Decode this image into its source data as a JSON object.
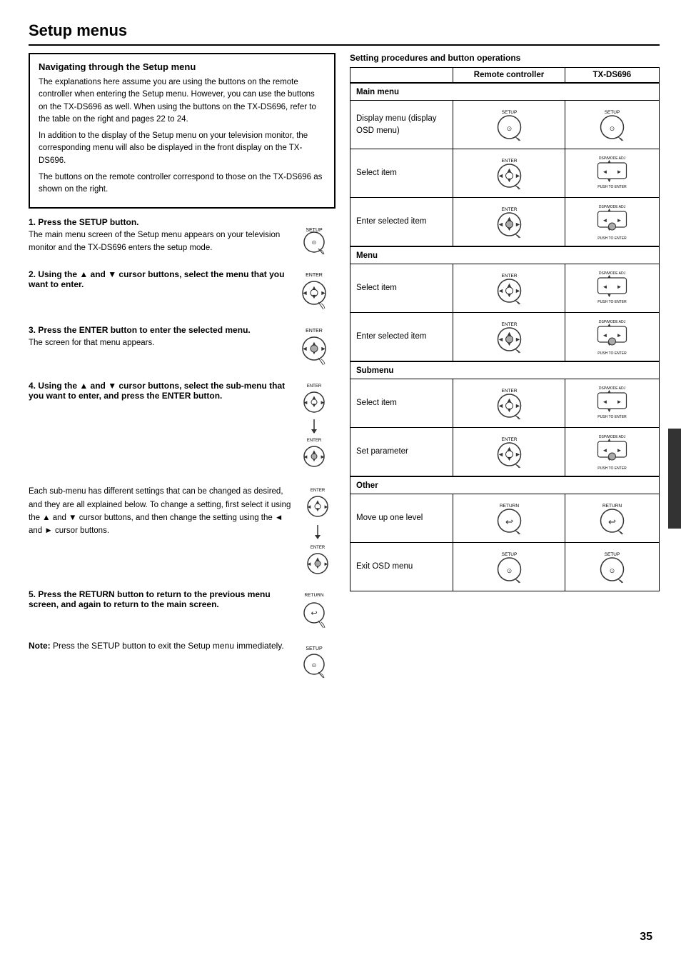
{
  "page": {
    "title": "Setup menus",
    "number": "35"
  },
  "left": {
    "nav_box": {
      "heading": "Navigating through the Setup menu",
      "paragraphs": [
        "The explanations here assume you are using the buttons on the remote controller when entering the Setup menu. However, you can use the buttons on the TX-DS696 as well. When using the buttons on the TX-DS696, refer to the table on the right and pages 22 to 24.",
        "In addition to the display of the Setup menu on your television monitor, the corresponding menu will also be displayed in the front display on the TX-DS696.",
        "The buttons on the remote controller correspond to those on the TX-DS696 as shown on the right."
      ]
    },
    "steps": [
      {
        "id": 1,
        "header": "Press the SETUP button.",
        "detail": "The main menu screen of the Setup menu appears on your television monitor and the TX-DS696 enters the setup mode.",
        "icon_type": "setup"
      },
      {
        "id": 2,
        "header": "Using the ▲ and ▼ cursor buttons, select the menu that you want to enter.",
        "detail": "",
        "icon_type": "enter"
      },
      {
        "id": 3,
        "header": "Press the ENTER button to enter the selected menu.",
        "detail": "The screen for that menu appears.",
        "icon_type": "enter"
      },
      {
        "id": 4,
        "header": "Using the ▲ and ▼ cursor buttons, select the sub-menu that you want to enter, and press the ENTER button.",
        "detail": "",
        "icon_type": "enter_multi"
      }
    ],
    "extra_text": "Each sub-menu has different settings that can be changed as desired, and they are all explained below. To change a setting, first select it using the ▲ and ▼ cursor buttons, and then change the setting using the ◄ and ► cursor buttons.",
    "step5": {
      "header": "Press the RETURN button to return to the previous menu screen, and again to return to the main screen.",
      "icon_type": "return"
    },
    "note": {
      "label": "Note:",
      "text": "Press the SETUP button to exit the Setup menu immediately.",
      "icon_type": "setup"
    }
  },
  "right": {
    "title": "Setting procedures and button operations",
    "table": {
      "headers": [
        "",
        "Remote controller",
        "TX-DS696"
      ],
      "sections": [
        {
          "section_label": "Main menu",
          "rows": [
            {
              "action": "Display menu\n(display OSD menu)",
              "rc_icon": "setup",
              "tx_icon": "setup_tx"
            },
            {
              "action": "Select item",
              "rc_icon": "enter",
              "tx_icon": "dsp_mode"
            },
            {
              "action": "Enter selected item",
              "rc_icon": "enter_press",
              "tx_icon": "dsp_mode_enter"
            }
          ]
        },
        {
          "section_label": "Menu",
          "rows": [
            {
              "action": "Select item",
              "rc_icon": "enter",
              "tx_icon": "dsp_mode"
            },
            {
              "action": "Enter selected item",
              "rc_icon": "enter_press",
              "tx_icon": "dsp_mode_enter"
            }
          ]
        },
        {
          "section_label": "Submenu",
          "rows": [
            {
              "action": "Select item",
              "rc_icon": "enter",
              "tx_icon": "dsp_mode"
            },
            {
              "action": "Set parameter",
              "rc_icon": "enter",
              "tx_icon": "dsp_mode_enter"
            }
          ]
        },
        {
          "section_label": "Other",
          "rows": [
            {
              "action": "Move up one level",
              "rc_icon": "return",
              "tx_icon": "return_tx"
            },
            {
              "action": "Exit OSD menu",
              "rc_icon": "setup",
              "tx_icon": "setup_tx"
            }
          ]
        }
      ]
    }
  }
}
